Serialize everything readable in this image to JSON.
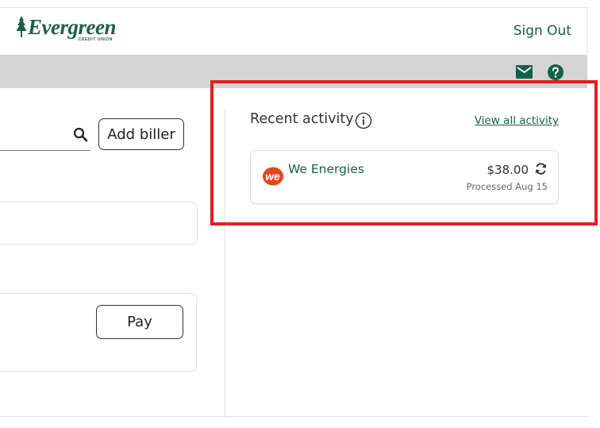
{
  "header": {
    "logo_name": "Evergreen",
    "logo_sub": "CREDIT UNION",
    "sign_out_label": "Sign Out"
  },
  "toolbar": {
    "icons": [
      "mail-icon",
      "help-icon"
    ]
  },
  "bill_pay": {
    "add_biller_label": "Add biller",
    "pay_label": "Pay",
    "search_icon": "search-icon"
  },
  "recent_activity": {
    "title": "Recent activity",
    "view_all_label": "View all activity",
    "items": [
      {
        "payee": "We Energies",
        "logo_text": "we",
        "amount": "$38.00",
        "status": "Processed Aug 15",
        "recurring_icon": "recurring-icon"
      }
    ]
  },
  "colors": {
    "brand_green": "#13614a",
    "band_grey": "#d4d4d4",
    "highlight_red": "#e02020",
    "payee_logo_orange": "#e8441b"
  }
}
